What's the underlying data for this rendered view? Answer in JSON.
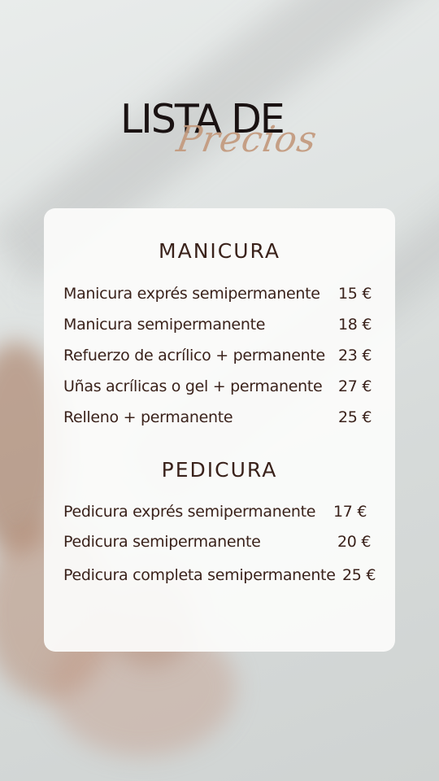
{
  "title": {
    "line1": "LISTA DE",
    "script": "Precios"
  },
  "sections": [
    {
      "heading": "MANICURA",
      "items": [
        {
          "name": "Manicura exprés semipermanente",
          "price": "15 €"
        },
        {
          "name": "Manicura semipermanente",
          "price": "18 €"
        },
        {
          "name": "Refuerzo de acrílico + permanente",
          "price": "23 €"
        },
        {
          "name": "Uñas acrílicas o gel + permanente",
          "price": "27 €"
        },
        {
          "name": "Relleno + permanente",
          "price": "25 €"
        }
      ]
    },
    {
      "heading": "PEDICURA",
      "items": [
        {
          "name": "Pedicura exprés semipermanente",
          "price": "17 €"
        },
        {
          "name": "Pedicura semipermanente",
          "price": "20 €"
        },
        {
          "name": "Pedicura completa semipermanente",
          "price": "25 €"
        }
      ]
    }
  ],
  "colors": {
    "text": "#3a221b",
    "title": "#1a1212",
    "accent_script": "#c39a7e",
    "card": "#fcfcfb"
  }
}
